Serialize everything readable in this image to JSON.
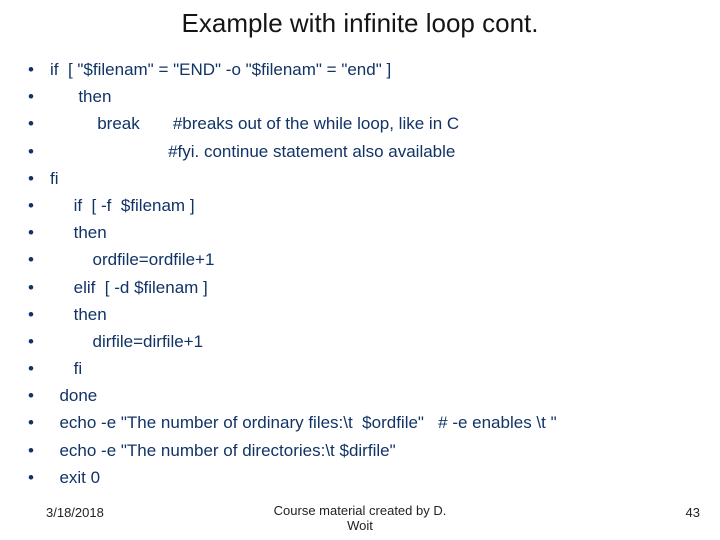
{
  "title": "Example with infinite loop cont.",
  "lines": [
    "if  [ \"$filenam\" = \"END\" -o \"$filenam\" = \"end\" ]",
    "      then",
    "          break       #breaks out of the while loop, like in C",
    "                         #fyi. continue statement also available",
    "fi",
    "     if  [ -f  $filenam ]",
    "     then",
    "         ordfile=ordfile+1",
    "     elif  [ -d $filenam ]",
    "     then",
    "         dirfile=dirfile+1",
    "     fi",
    "  done",
    "  echo -e \"The number of ordinary files:\\t  $ordfile\"   # -e enables \\t \"",
    "  echo -e \"The number of directories:\\t $dirfile\"",
    "  exit 0"
  ],
  "footer": {
    "date": "3/18/2018",
    "center": "Course material created by D.\nWoit",
    "page": "43"
  }
}
